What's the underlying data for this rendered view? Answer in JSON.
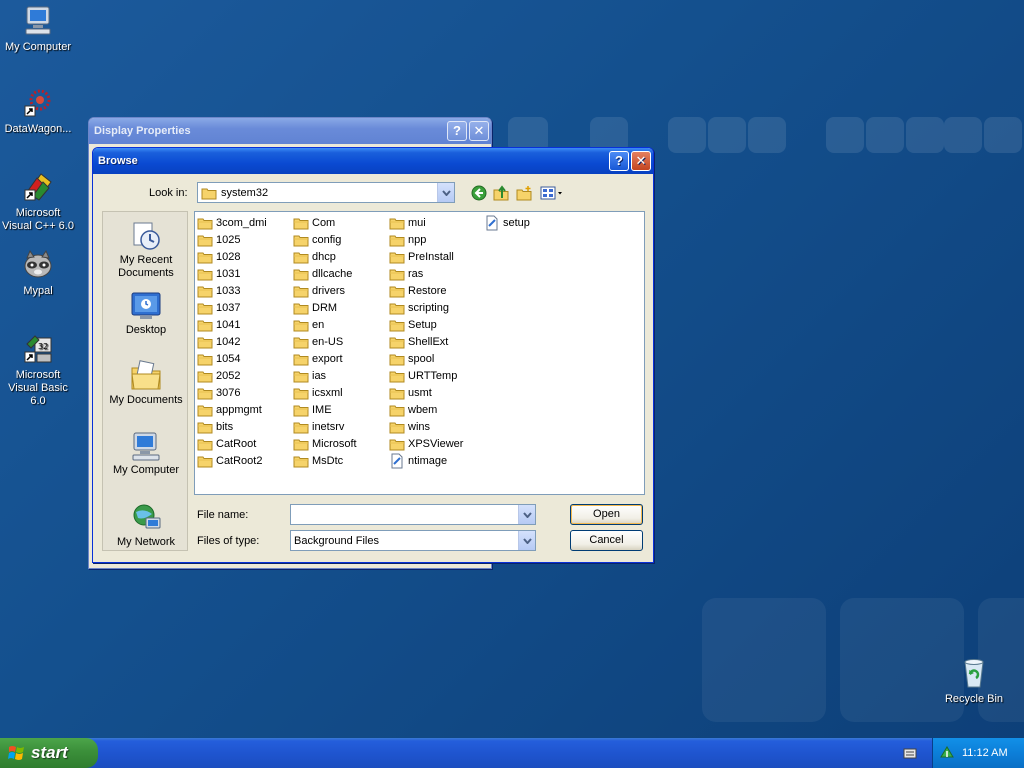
{
  "desktop": {
    "icons": [
      {
        "label": "My Computer"
      },
      {
        "label": "DataWagon..."
      },
      {
        "label": "Microsoft Visual C++ 6.0"
      },
      {
        "label": "Mypal"
      },
      {
        "label": "Microsoft Visual Basic 6.0"
      },
      {
        "label": "Recycle Bin"
      }
    ]
  },
  "display_properties": {
    "title": "Display Properties",
    "help": "?",
    "close": "✕"
  },
  "browse": {
    "title": "Browse",
    "help": "?",
    "close": "✕",
    "look_in_label": "Look in:",
    "look_in_value": "system32",
    "places": [
      {
        "label": "My Recent Documents"
      },
      {
        "label": "Desktop"
      },
      {
        "label": "My Documents"
      },
      {
        "label": "My Computer"
      },
      {
        "label": "My Network"
      }
    ],
    "files": {
      "col1": [
        "3com_dmi",
        "1025",
        "1028",
        "1031",
        "1033",
        "1037",
        "1041",
        "1042",
        "1054",
        "2052",
        "3076",
        "appmgmt",
        "bits",
        "CatRoot",
        "CatRoot2"
      ],
      "col2": [
        "Com",
        "config",
        "dhcp",
        "dllcache",
        "drivers",
        "DRM",
        "en",
        "en-US",
        "export",
        "ias",
        "icsxml",
        "IME",
        "inetsrv",
        "Microsoft",
        "MsDtc"
      ],
      "col3": [
        "mui",
        "npp",
        "PreInstall",
        "ras",
        "Restore",
        "scripting",
        "Setup",
        "ShellExt",
        "spool",
        "URTTemp",
        "usmt",
        "wbem",
        "wins",
        "XPSViewer",
        "ntimage"
      ],
      "col4": [
        "setup"
      ]
    },
    "file_name_label": "File name:",
    "file_name_value": "",
    "files_of_type_label": "Files of type:",
    "files_of_type_value": "Background Files",
    "open_label": "Open",
    "cancel_label": "Cancel"
  },
  "taskbar": {
    "start_label": "start",
    "clock": "11:12 AM"
  }
}
